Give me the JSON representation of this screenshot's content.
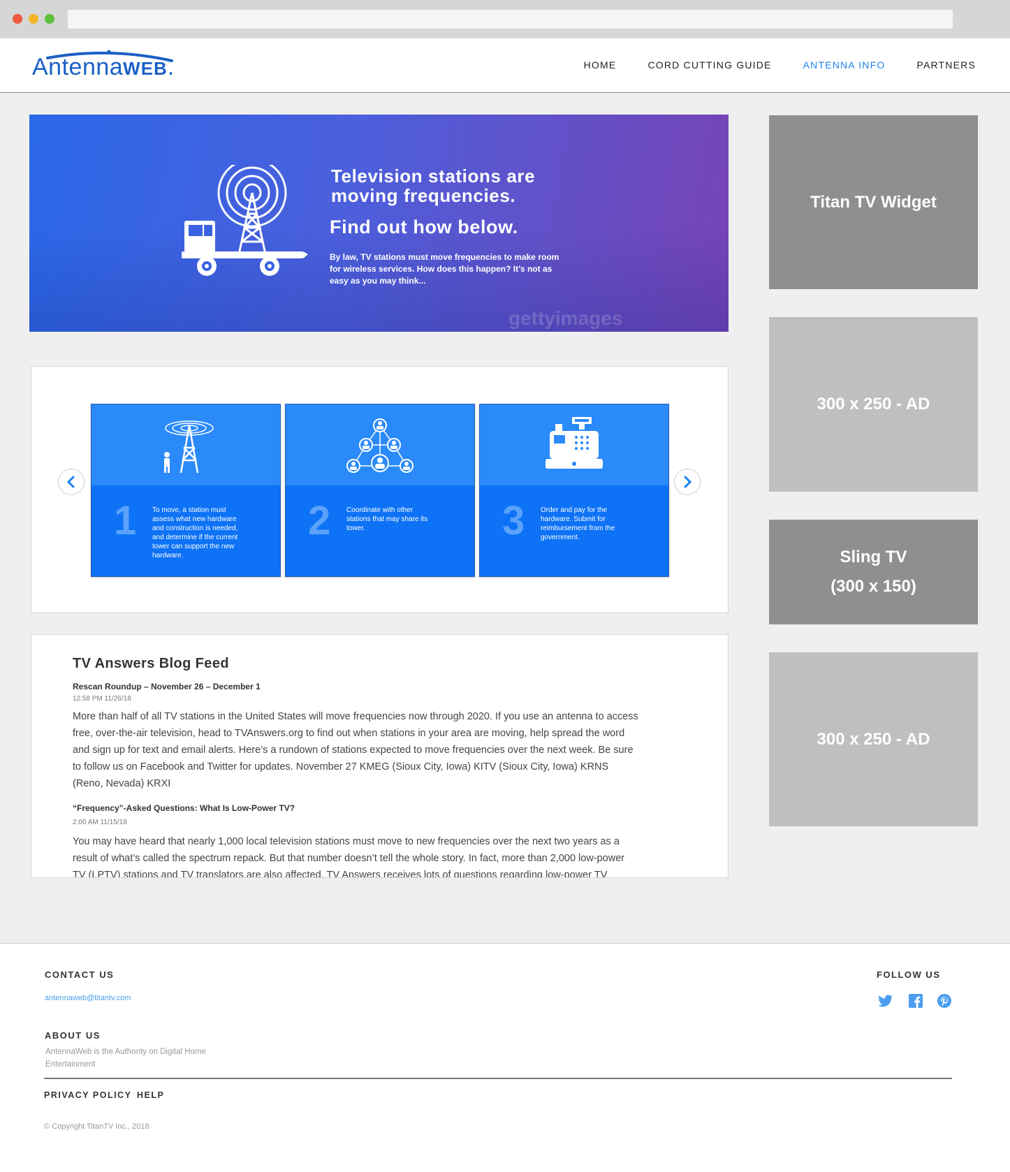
{
  "logo": {
    "text_main": "Antenna",
    "text_web": "WEB",
    "dot": "."
  },
  "nav": {
    "items": [
      {
        "label": "HOME"
      },
      {
        "label": "CORD CUTTING GUIDE"
      },
      {
        "label": "ANTENNA INFO"
      },
      {
        "label": "PARTNERS"
      }
    ],
    "active_index": 2
  },
  "hero": {
    "title": "Television stations are moving frequencies.",
    "subtitle": "Find out how below.",
    "body": "By law, TV stations must move frequencies to make room for wireless services. How does this happen? It’s not as easy as you may think...",
    "watermark": "gettyimages"
  },
  "carousel": {
    "cards": [
      {
        "number": "1",
        "icon": "tower-icon",
        "text": "To move, a station must assess what new hardware and construction is needed, and determine if the current tower can support the new hardware."
      },
      {
        "number": "2",
        "icon": "network-people-icon",
        "text": "Coordinate with other stations that may share its tower."
      },
      {
        "number": "3",
        "icon": "cash-register-icon",
        "text": "Order and pay for the hardware. Submit for reimbursement from the government."
      }
    ]
  },
  "blog": {
    "title": "TV Answers Blog Feed",
    "posts": [
      {
        "title": "Rescan Roundup – November 26 – December 1",
        "time": "12:58 PM 11/26/18",
        "body": "More than half of all TV stations in the United States will move frequencies now through 2020. If you use an antenna to access free, over-the-air television, head to TVAnswers.org to find out when stations in your area are moving, help spread the word and sign up for text and email alerts. Here’s a rundown of stations expected to move frequencies over the next week. Be sure to follow us on Facebook and Twitter for updates. November 27 KMEG (Sioux City, Iowa) KITV (Sioux City, Iowa) KRNS (Reno, Nevada) KRXI"
      },
      {
        "title": "“Frequency”-Asked Questions: What Is Low-Power TV?",
        "time": "2:00 AM 11/15/18",
        "body": "You may have heard that nearly 1,000 local television stations must move to new frequencies over the next two years as a result of what’s called the spectrum repack. But that number doesn’t tell the whole story. In fact, more than 2,000 low-power TV (LPTV) stations and TV translators are also affected. TV Answers receives lots of questions regarding low-power TV"
      }
    ]
  },
  "sidebar": {
    "ads": [
      {
        "line1": "Titan TV Widget",
        "line2": ""
      },
      {
        "line1": "300 x 250 - AD",
        "line2": ""
      },
      {
        "line1": "Sling TV",
        "line2": "(300 x 150)"
      },
      {
        "line1": "300 x 250 - AD",
        "line2": ""
      }
    ]
  },
  "footer": {
    "contact_heading": "CONTACT US",
    "contact_email": "antennaweb@titantv.com",
    "about_heading": "ABOUT US",
    "about_text": "AntennaWeb is the Authority on Digital Home Entertainment",
    "follow_heading": "FOLLOW US",
    "social_icons": [
      "twitter-icon",
      "facebook-icon",
      "pinterest-icon"
    ],
    "links": [
      {
        "label": "PRIVACY POLICY"
      },
      {
        "label": "HELP"
      }
    ],
    "copyright": "© Copyright TitanTV Inc., 2018"
  },
  "colors": {
    "accent": "#1d80f0",
    "card_blue": "#0d72f5",
    "ad_dark": "#8f8f8f",
    "ad_light": "#bfbfbf",
    "social": "#4a9df0"
  }
}
